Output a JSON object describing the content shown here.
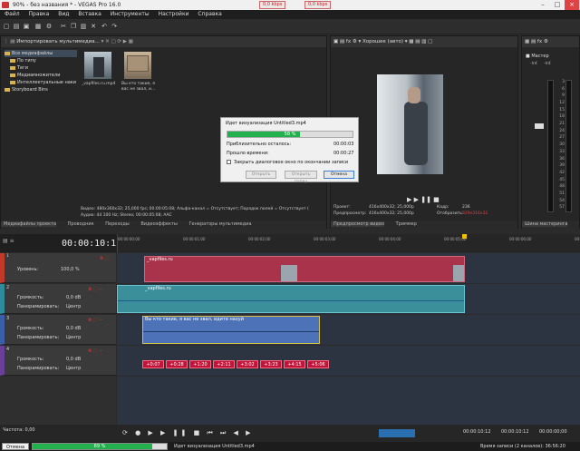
{
  "window": {
    "title": "90% - без названия * - VEGAS Pro 16.0",
    "kbps_left": "0,0 kbps",
    "kbps_right": "0,0 kbps"
  },
  "menu": [
    "Файл",
    "Правка",
    "Вид",
    "Вставка",
    "Инструменты",
    "Настройки",
    "Справка"
  ],
  "media_panel": {
    "import_label": "Импортировать мультимедиа...",
    "tree": [
      "Все медиафайлы",
      "По типу",
      "Теги",
      "Медиамножители",
      "Интеллектуальные наки",
      "Storyboard Bins"
    ],
    "thumbs": [
      {
        "caption": "_vapfiles.ru.mp4"
      },
      {
        "caption": "Вы кто такие, я вас не звал, и..."
      }
    ],
    "info_line1": "Видео: 480x360x32; 25,000 fps; 00:00:05:08; Альфа-канал = Отсутствует; Порядок полей = Отсутствует (",
    "info_line2": "Аудио: 44 100 Hz; Stereo; 00:00:05:08; AAC",
    "tabs": [
      "Медиафайлы проекта",
      "Проводник",
      "Переходы",
      "Видеоэффекты",
      "Генераторы мультимедиа"
    ]
  },
  "preview": {
    "quality": "Хорошее (авто)",
    "project_label": "Проект:",
    "project_value": "416x400x32; 25,000p",
    "preview_label": "Предпросмотр:",
    "preview_value": "416x400x32; 25,000p",
    "frame_label": "Кадр:",
    "frame_value": "236",
    "display_label": "Отобразить:",
    "display_value": "329x316x32",
    "tabs": [
      "Предпросмотр видео",
      "Триммер"
    ]
  },
  "master": {
    "title": "Мастер",
    "scale": [
      "3",
      "6",
      "9",
      "12",
      "15",
      "18",
      "21",
      "24",
      "27",
      "30",
      "33",
      "36",
      "39",
      "42",
      "45",
      "48",
      "51",
      "54",
      "57"
    ],
    "tab": "Шина мастеринга",
    "db_left": "-Inf.",
    "db_right": "-Inf."
  },
  "dialog": {
    "title": "Идет визуализация Untitled3.mp4",
    "percent": "58 %",
    "progress": 0.58,
    "remaining_label": "Приблизительно осталось:",
    "remaining_value": "00:00:03",
    "elapsed_label": "Прошло времени:",
    "elapsed_value": "00:00:27",
    "checkbox_label": "Закрыть диалоговое окно по окончании записи",
    "buttons": [
      "Открыть",
      "Открыть папку",
      "Отмена"
    ]
  },
  "timeline": {
    "timecode": "00:00:10:12",
    "ruler": [
      "00:00:00;00",
      "00:00:01;00",
      "00:00:02;00",
      "00:00:03;00",
      "00:00:04;00",
      "00:00:05;00",
      "00:00:06;00",
      "00:00:07;00"
    ],
    "tracks": [
      {
        "num": "1",
        "label": "Уровень:",
        "value": "100,0 %",
        "clip": "_vapfiles.ru"
      },
      {
        "num": "2",
        "label": "Громкость:",
        "value": "0,0 dB",
        "pan_label": "Панорамировать:",
        "pan_value": "Центр",
        "clip": "_vapfiles.ru"
      },
      {
        "num": "3",
        "label": "Громкость:",
        "value": "0,0 dB",
        "pan_label": "Панорамировать:",
        "pan_value": "Центр",
        "clip": "Вы кто такие, я вас не звал, идите нахуй"
      },
      {
        "num": "4",
        "label": "Громкость:",
        "value": "0,0 dB",
        "pan_label": "Панорамировать:",
        "pan_value": "Центр"
      }
    ],
    "pitch_markers": [
      "+0:07",
      "+0:28",
      "+1:20",
      "+2:11",
      "+3:02",
      "+3:23",
      "+4:15",
      "+5:06"
    ],
    "rate_label": "Частота: 0,00",
    "time_right1": "00:00:10:12",
    "time_right2": "00:00:10:12",
    "time_right3": "00:00:00;00"
  },
  "status": {
    "cancel": "Отмена",
    "percent": "89 %",
    "progress": 0.89,
    "text": "Идет визуализация Untitled3.mp4",
    "record_time": "Время записи (2 каналов): 36:56:20"
  }
}
